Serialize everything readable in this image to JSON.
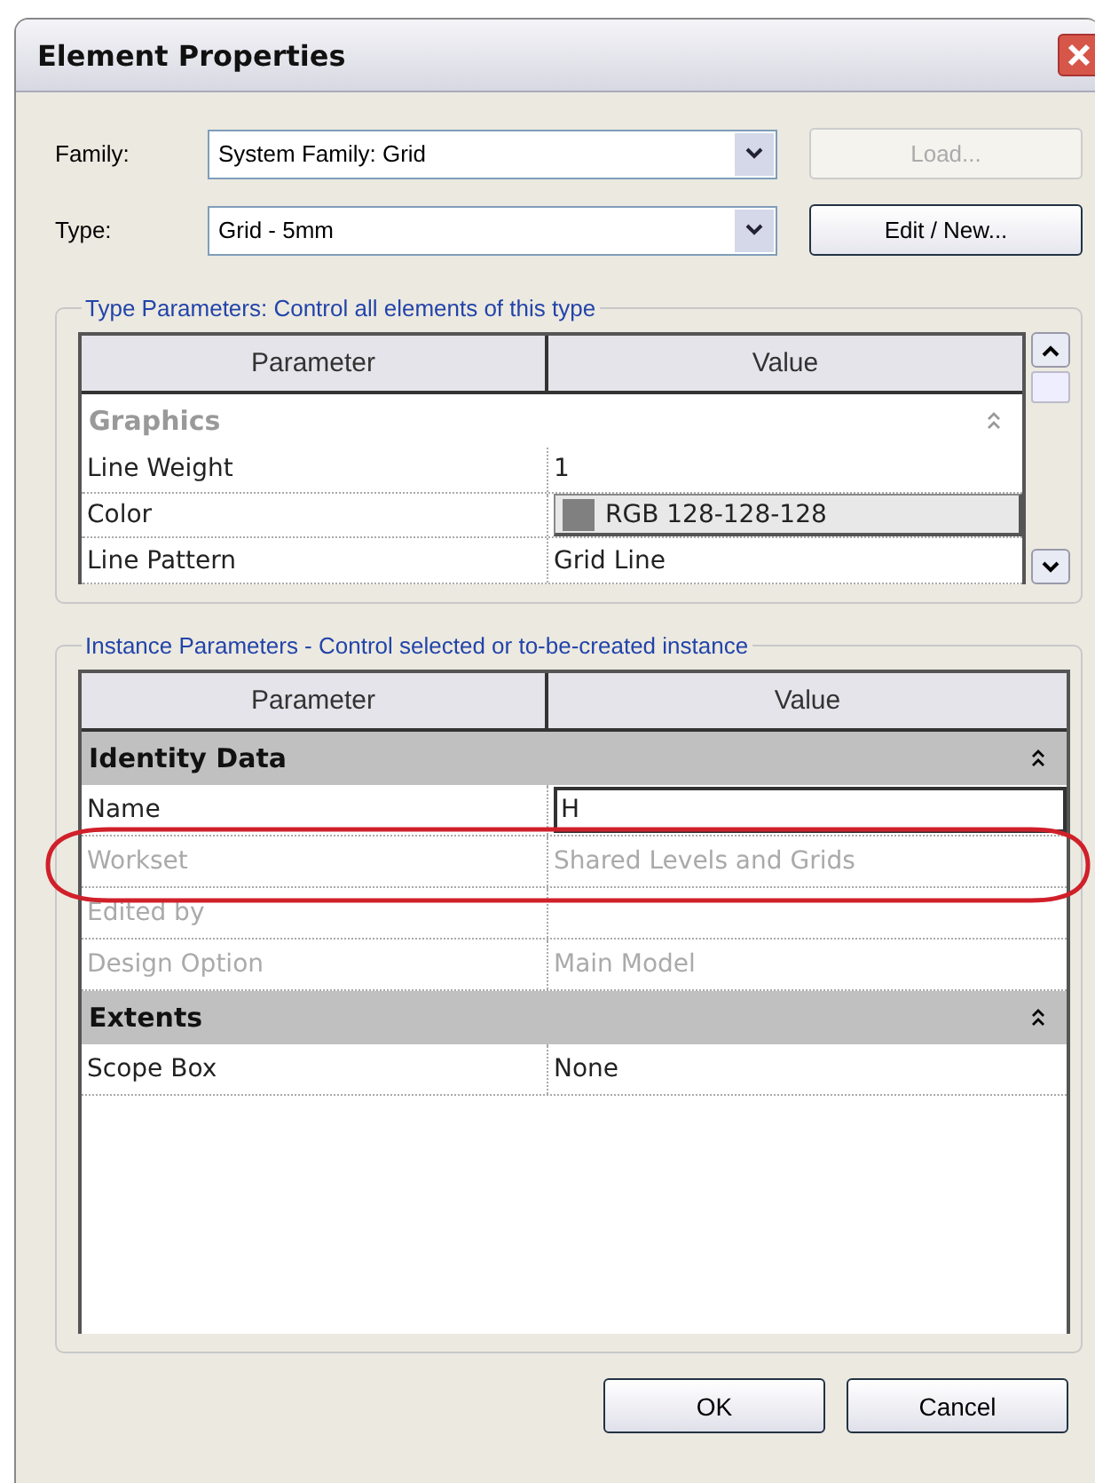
{
  "window": {
    "title": "Element Properties"
  },
  "family": {
    "label": "Family:",
    "value": "System Family: Grid"
  },
  "type": {
    "label": "Type:",
    "value": "Grid - 5mm"
  },
  "buttons_top": [
    {
      "label": "Load...",
      "disabled": true
    },
    {
      "label": "Edit / New...",
      "disabled": false
    }
  ],
  "type_parameters": {
    "legend": "Type Parameters: Control all elements of this type",
    "columns": [
      "Parameter",
      "Value"
    ],
    "groups": [
      {
        "name": "Graphics",
        "disabled": true,
        "rows": [
          {
            "kind": "text",
            "parameter": "Line Weight",
            "value": "1",
            "disabled": false
          },
          {
            "kind": "color",
            "parameter": "Color",
            "value": "RGB 128-128-128",
            "color": "#808080",
            "disabled": false
          },
          {
            "kind": "text",
            "parameter": "Line Pattern",
            "value": "Grid Line",
            "disabled": false
          }
        ]
      }
    ]
  },
  "instance_parameters": {
    "legend": "Instance Parameters - Control selected or to-be-created instance",
    "columns": [
      "Parameter",
      "Value"
    ],
    "groups": [
      {
        "name": "Identity Data",
        "disabled": false,
        "rows": [
          {
            "kind": "edit",
            "parameter": "Name",
            "value": "H",
            "disabled": false
          },
          {
            "kind": "text",
            "parameter": "Workset",
            "value": "Shared Levels and Grids",
            "disabled": true,
            "highlighted": true
          },
          {
            "kind": "text",
            "parameter": "Edited by",
            "disabled": true
          },
          {
            "kind": "text",
            "parameter": "Design Option",
            "value": "Main Model",
            "disabled": true
          }
        ]
      },
      {
        "name": "Extents",
        "disabled": false,
        "rows": [
          {
            "kind": "text",
            "parameter": "Scope Box",
            "value": "None",
            "disabled": false
          }
        ]
      }
    ]
  },
  "buttons": [
    {
      "label": "OK"
    },
    {
      "label": "Cancel"
    }
  ]
}
